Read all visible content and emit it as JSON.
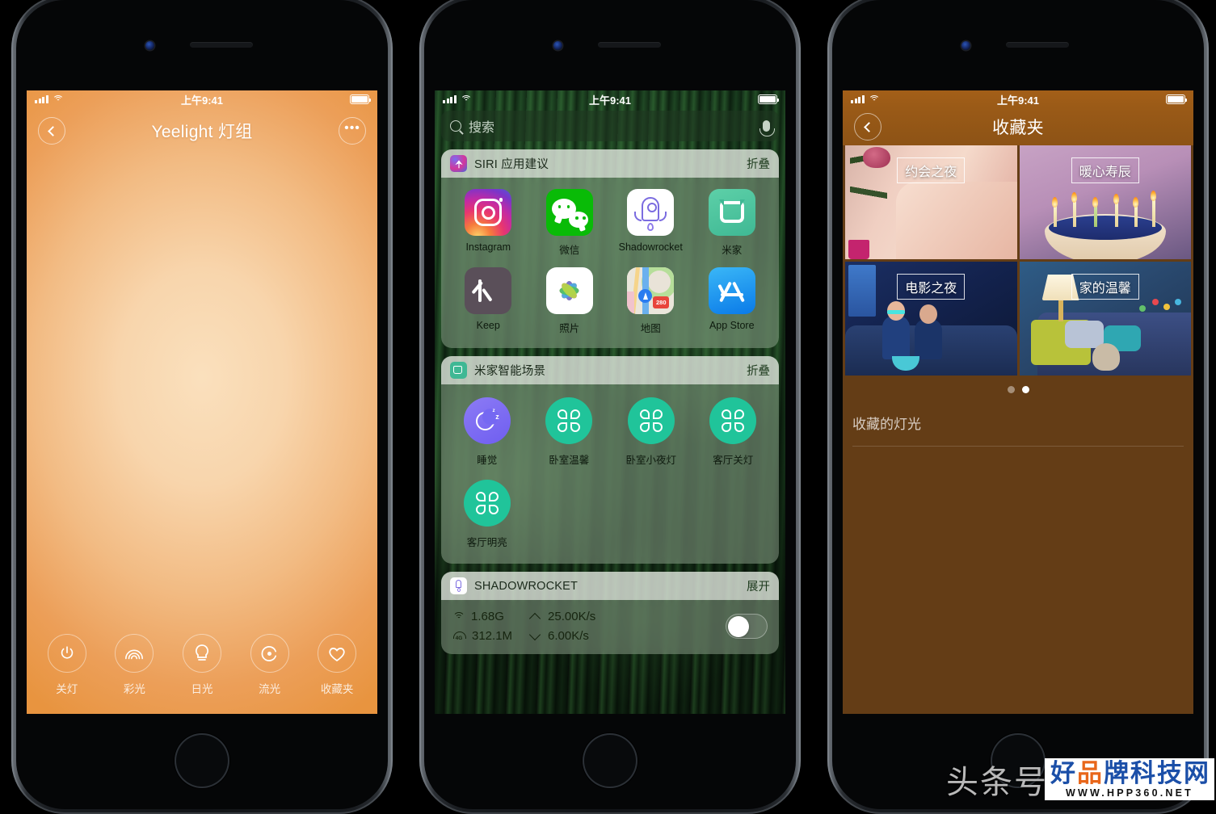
{
  "phones": {
    "status_bar": {
      "time": "上午9:41",
      "signal": "signal-bars-icon",
      "wifi": "wifi-icon",
      "battery": "battery-icon"
    }
  },
  "screen1": {
    "nav": {
      "back": "back-chevron-icon",
      "title": "Yeelight 灯组",
      "more": "•••"
    },
    "toolbar": [
      {
        "icon": "power-icon",
        "label": "关灯"
      },
      {
        "icon": "rainbow-icon",
        "label": "彩光"
      },
      {
        "icon": "bulb-icon",
        "label": "日光"
      },
      {
        "icon": "flow-icon",
        "label": "流光"
      },
      {
        "icon": "heart-icon",
        "label": "收藏夹"
      }
    ]
  },
  "screen2": {
    "search": {
      "placeholder": "搜索",
      "icon": "search-icon",
      "mic": "microphone-icon"
    },
    "widgets": [
      {
        "id": "siri-suggestions",
        "title": "SIRI 应用建议",
        "action": "折叠",
        "icon": "siri-icon",
        "apps": [
          {
            "name": "Instagram",
            "icon": "instagram-icon"
          },
          {
            "name": "微信",
            "icon": "wechat-icon"
          },
          {
            "name": "Shadowrocket",
            "icon": "shadowrocket-icon"
          },
          {
            "name": "米家",
            "icon": "mijia-icon"
          },
          {
            "name": "Keep",
            "icon": "keep-icon"
          },
          {
            "name": "照片",
            "icon": "photos-icon"
          },
          {
            "name": "地图",
            "icon": "maps-icon",
            "badge": "280"
          },
          {
            "name": "App Store",
            "icon": "appstore-icon"
          }
        ]
      },
      {
        "id": "mijia-scenes",
        "title": "米家智能场景",
        "action": "折叠",
        "icon": "mijia-icon",
        "scenes": [
          {
            "name": "睡觉",
            "icon": "moon-sleep-icon",
            "color": "#7568f2"
          },
          {
            "name": "卧室温馨",
            "icon": "clover-icon",
            "color": "#20c49a"
          },
          {
            "name": "卧室小夜灯",
            "icon": "clover-icon",
            "color": "#20c49a"
          },
          {
            "name": "客厅关灯",
            "icon": "clover-icon",
            "color": "#20c49a"
          },
          {
            "name": "客厅明亮",
            "icon": "clover-icon",
            "color": "#20c49a"
          }
        ]
      },
      {
        "id": "shadowrocket",
        "title": "SHADOWROCKET",
        "action": "展开",
        "icon": "shadowrocket-icon",
        "stats": [
          {
            "icon": "wifi-icon",
            "value": "1.68G"
          },
          {
            "icon": "4g-icon",
            "value": "312.1M"
          },
          {
            "icon": "arrow-up-icon",
            "value": "25.00K/s"
          },
          {
            "icon": "arrow-down-icon",
            "value": "6.00K/s"
          }
        ],
        "toggle": {
          "name": "proxy-toggle",
          "state": "off"
        }
      }
    ]
  },
  "screen3": {
    "nav": {
      "back": "back-chevron-icon",
      "title": "收藏夹"
    },
    "cards": [
      {
        "label": "约会之夜"
      },
      {
        "label": "暖心寿辰"
      },
      {
        "label": "电影之夜"
      },
      {
        "label": "家的温馨"
      }
    ],
    "pager": {
      "total": 2,
      "active": 2
    },
    "section_title": "收藏的灯光"
  },
  "watermark": {
    "prefix": "头条号",
    "logo_chars": [
      "好",
      "品",
      "牌",
      "科",
      "技",
      "网"
    ],
    "url": "WWW.HPP360.NET"
  }
}
